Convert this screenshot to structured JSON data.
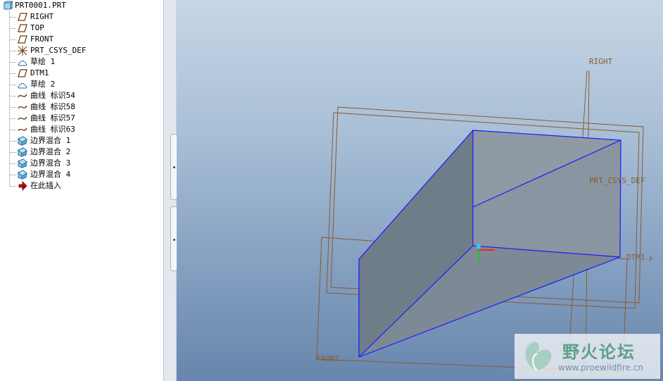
{
  "model_tree": {
    "root": "PRT0001.PRT",
    "items": [
      {
        "label": "RIGHT",
        "icon": "datum-plane-icon"
      },
      {
        "label": "TOP",
        "icon": "datum-plane-icon"
      },
      {
        "label": "FRONT",
        "icon": "datum-plane-icon"
      },
      {
        "label": "PRT_CSYS_DEF",
        "icon": "coordinate-system-icon"
      },
      {
        "label": "草绘 1",
        "icon": "sketch-icon"
      },
      {
        "label": "DTM1",
        "icon": "datum-plane-icon"
      },
      {
        "label": "草绘 2",
        "icon": "sketch-icon"
      },
      {
        "label": "曲线 标识54",
        "icon": "curve-icon"
      },
      {
        "label": "曲线 标识58",
        "icon": "curve-icon"
      },
      {
        "label": "曲线 标识57",
        "icon": "curve-icon"
      },
      {
        "label": "曲线 标识63",
        "icon": "curve-icon"
      },
      {
        "label": "边界混合 1",
        "icon": "boundary-blend-icon"
      },
      {
        "label": "边界混合 2",
        "icon": "boundary-blend-icon"
      },
      {
        "label": "边界混合 3",
        "icon": "boundary-blend-icon"
      },
      {
        "label": "边界混合 4",
        "icon": "boundary-blend-icon"
      },
      {
        "label": "在此插入",
        "icon": "insert-here-arrow-icon"
      }
    ]
  },
  "viewport": {
    "datum_labels": {
      "right": "RIGHT",
      "csys": "PRT_CSYS_DEF",
      "dtm": "DTM1",
      "dtm_suffix": "P",
      "front": "FRONT"
    },
    "colors": {
      "datum": "#8a5a2e",
      "edge": "#1a1aff",
      "surface": "#7d8894"
    }
  },
  "watermark": {
    "title": "野火论坛",
    "url": "www.proewildfire.cn"
  }
}
